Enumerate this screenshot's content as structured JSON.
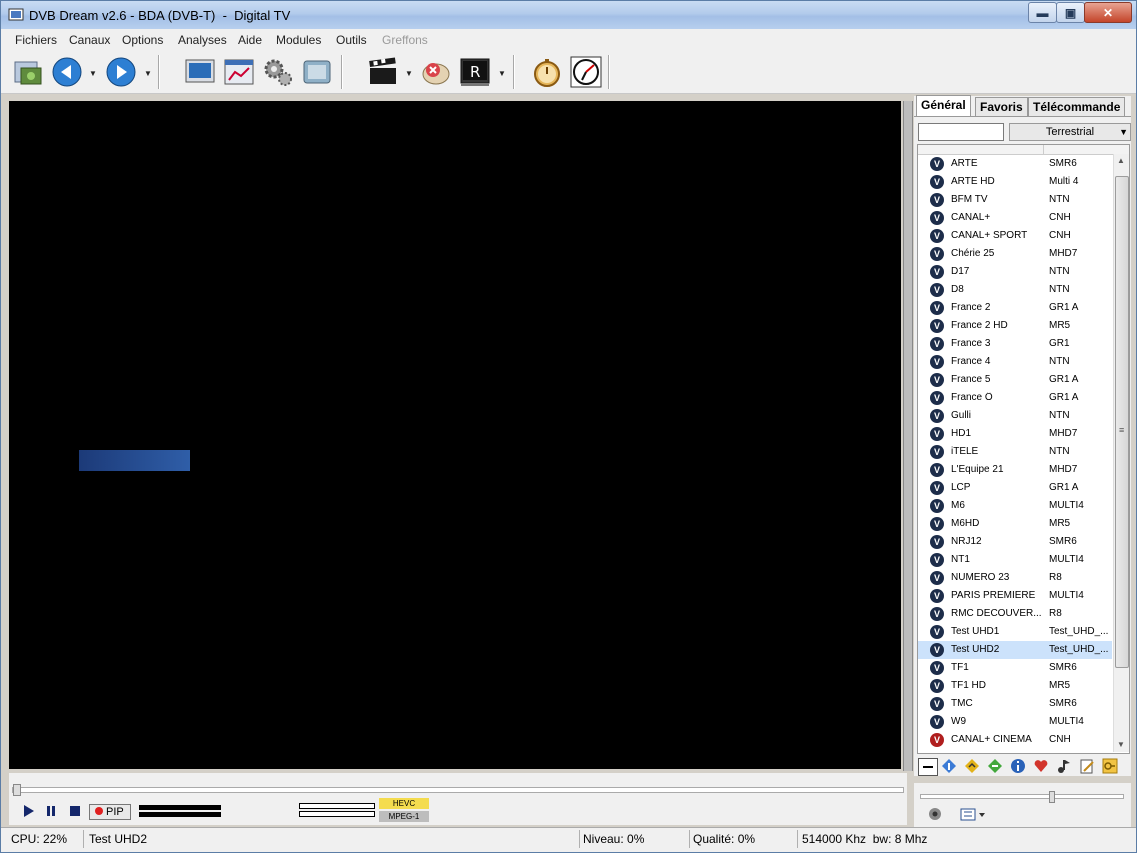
{
  "window": {
    "title": "DVB Dream v2.6 - BDA (DVB-T)  -  Digital TV",
    "minimize_glyph": "▬",
    "maximize_glyph": "▣",
    "close_glyph": "✕"
  },
  "menu": [
    "Fichiers",
    "Canaux",
    "Options",
    "Analyses",
    "Aide",
    "Modules",
    "Outils",
    "Greffons"
  ],
  "menu_disabled_index": 7,
  "toolbar_icons": [
    "open-file-icon",
    "back-icon",
    "forward-icon",
    "tv-screen-icon",
    "epg-window-icon",
    "settings-gears-icon",
    "picture-icon",
    "clapper-record-icon",
    "stop-record-icon",
    "recorder-r-icon",
    "timer-stopwatch-icon",
    "scheduler-clock-icon"
  ],
  "panel": {
    "tabs": [
      "Général",
      "Favoris",
      "Télécommande"
    ],
    "filter_value": "",
    "network_select": "Terrestrial",
    "selected_index": 27,
    "channels": [
      {
        "name": "ARTE",
        "mux": "SMR6",
        "icon": "V"
      },
      {
        "name": "ARTE HD",
        "mux": "Multi 4",
        "icon": "V"
      },
      {
        "name": "BFM TV",
        "mux": "NTN",
        "icon": "V"
      },
      {
        "name": "CANAL+",
        "mux": "CNH",
        "icon": "V"
      },
      {
        "name": "CANAL+ SPORT",
        "mux": "CNH",
        "icon": "V"
      },
      {
        "name": "Chérie 25",
        "mux": "MHD7",
        "icon": "V"
      },
      {
        "name": "D17",
        "mux": "NTN",
        "icon": "V"
      },
      {
        "name": "D8",
        "mux": "NTN",
        "icon": "V"
      },
      {
        "name": "France 2",
        "mux": "GR1 A",
        "icon": "V"
      },
      {
        "name": "France 2 HD",
        "mux": "MR5",
        "icon": "V"
      },
      {
        "name": "France 3",
        "mux": "GR1",
        "icon": "V"
      },
      {
        "name": "France 4",
        "mux": "NTN",
        "icon": "V"
      },
      {
        "name": "France 5",
        "mux": "GR1 A",
        "icon": "V"
      },
      {
        "name": "France Ô",
        "mux": "GR1 A",
        "icon": "V"
      },
      {
        "name": "Gulli",
        "mux": "NTN",
        "icon": "V"
      },
      {
        "name": "HD1",
        "mux": "MHD7",
        "icon": "V"
      },
      {
        "name": "iTELE",
        "mux": "NTN",
        "icon": "V"
      },
      {
        "name": "L'Equipe 21",
        "mux": "MHD7",
        "icon": "V"
      },
      {
        "name": "LCP",
        "mux": "GR1 A",
        "icon": "V"
      },
      {
        "name": "M6",
        "mux": "MULTI4",
        "icon": "V"
      },
      {
        "name": "M6HD",
        "mux": "MR5",
        "icon": "V"
      },
      {
        "name": "NRJ12",
        "mux": "SMR6",
        "icon": "V"
      },
      {
        "name": "NT1",
        "mux": "MULTI4",
        "icon": "V"
      },
      {
        "name": "NUMERO 23",
        "mux": "R8",
        "icon": "V"
      },
      {
        "name": "PARIS PREMIERE",
        "mux": "MULTI4",
        "icon": "V"
      },
      {
        "name": "RMC DECOUVER...",
        "mux": "R8",
        "icon": "V"
      },
      {
        "name": "Test UHD1",
        "mux": "Test_UHD_...",
        "icon": "V"
      },
      {
        "name": "Test UHD2",
        "mux": "Test_UHD_...",
        "icon": "V"
      },
      {
        "name": "TF1",
        "mux": "SMR6",
        "icon": "V"
      },
      {
        "name": "TF1 HD",
        "mux": "MR5",
        "icon": "V"
      },
      {
        "name": "TMC",
        "mux": "SMR6",
        "icon": "V"
      },
      {
        "name": "W9",
        "mux": "MULTI4",
        "icon": "V"
      },
      {
        "name": "CANAL+ CINEMA",
        "mux": "CNH",
        "icon": "V",
        "red": true
      }
    ],
    "bottom_icons": [
      "minus-icon",
      "info-blue-icon",
      "diamond-yellow-icon",
      "diamond-green-icon",
      "info-icon",
      "heart-icon",
      "music-icon",
      "edit-icon",
      "key-icon"
    ]
  },
  "controls": {
    "pip_label": "PIP",
    "codec_video": "HEVC",
    "codec_audio": "MPEG-1"
  },
  "status": {
    "cpu": "CPU: 22%",
    "channel": "Test UHD2",
    "niveau": "Niveau: 0%",
    "qualite": "Qualité: 0%",
    "freq": "514000 Khz  bw: 8 Mhz"
  }
}
